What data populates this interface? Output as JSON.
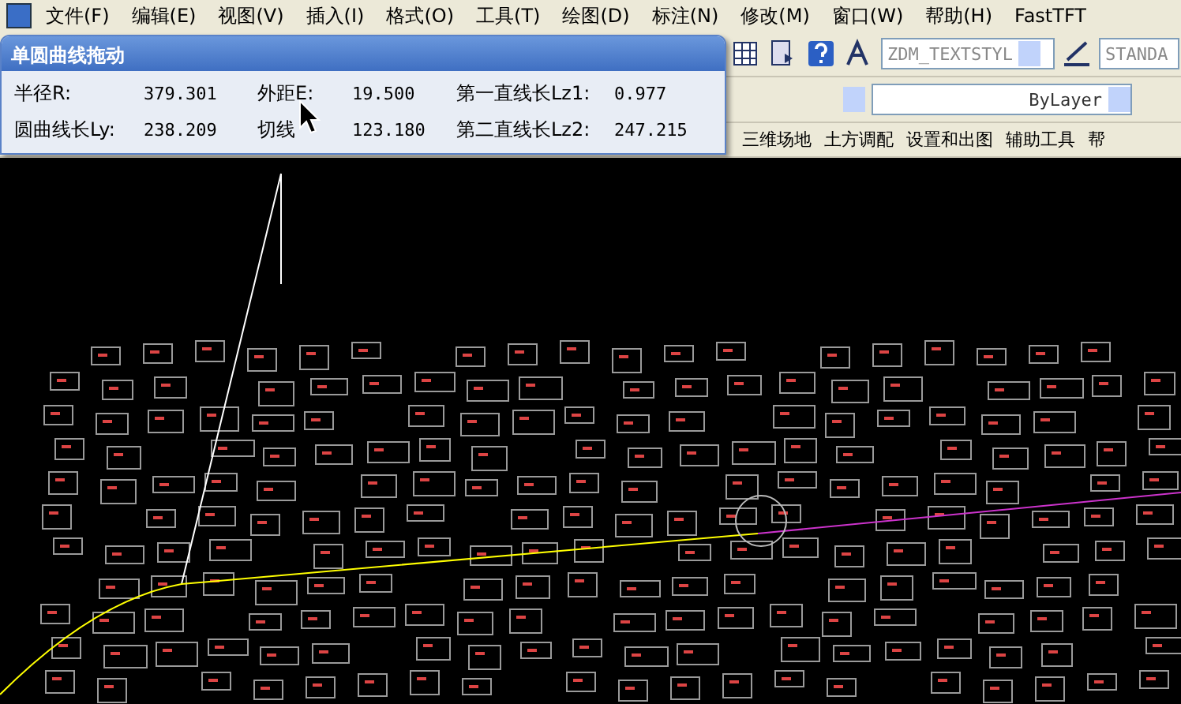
{
  "menu": [
    {
      "label": "文件(F)"
    },
    {
      "label": "编辑(E)"
    },
    {
      "label": "视图(V)"
    },
    {
      "label": "插入(I)"
    },
    {
      "label": "格式(O)"
    },
    {
      "label": "工具(T)"
    },
    {
      "label": "绘图(D)"
    },
    {
      "label": "标注(N)"
    },
    {
      "label": "修改(M)"
    },
    {
      "label": "窗口(W)"
    },
    {
      "label": "帮助(H)"
    },
    {
      "label": "FastTFT"
    }
  ],
  "toolbar": {
    "text_style": "ZDM_TEXTSTYL",
    "dim_style": "STANDA",
    "linetype": "ByLayer"
  },
  "popup": {
    "title": "单圆曲线拖动",
    "rows": [
      [
        {
          "label": "半径R:",
          "value": "379.301"
        },
        {
          "label": "外距E:",
          "value": "19.500"
        },
        {
          "label": "第一直线长Lz1:",
          "value": "0.977"
        }
      ],
      [
        {
          "label": "圆曲线长Ly:",
          "value": "238.209"
        },
        {
          "label": "切线",
          "value": "123.180"
        },
        {
          "label": "第二直线长Lz2:",
          "value": "247.215"
        }
      ]
    ]
  },
  "ribbon": [
    {
      "label": "三维场地"
    },
    {
      "label": "土方调配"
    },
    {
      "label": "设置和出图"
    },
    {
      "label": "辅助工具"
    },
    {
      "label": "帮"
    }
  ]
}
